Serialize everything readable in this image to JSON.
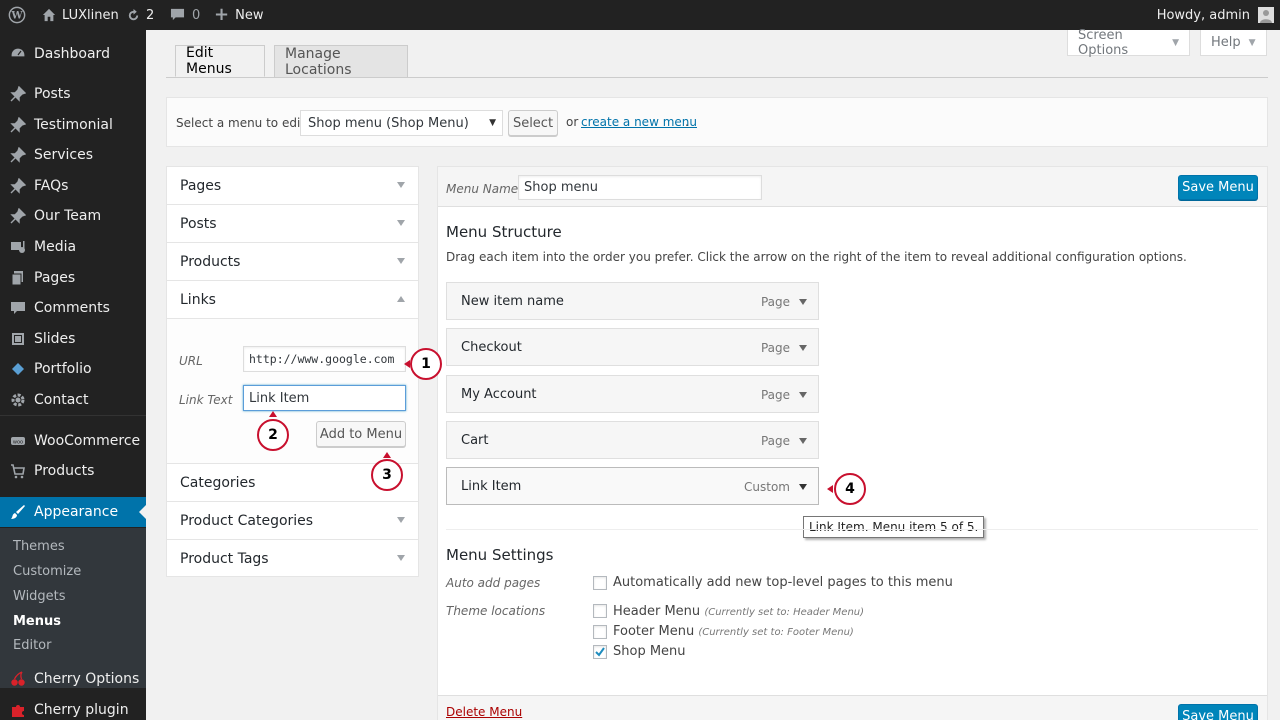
{
  "admin_bar": {
    "site_name": "LUXlinen",
    "updates_count": "2",
    "comments_count": "0",
    "new_label": "New",
    "howdy": "Howdy, admin"
  },
  "sidebar": {
    "items": [
      {
        "label": "Dashboard",
        "icon": "dashboard-icon"
      },
      {
        "label": "Posts",
        "icon": "pin-icon"
      },
      {
        "label": "Testimonial",
        "icon": "pin-icon"
      },
      {
        "label": "Services",
        "icon": "pin-icon"
      },
      {
        "label": "FAQs",
        "icon": "pin-icon"
      },
      {
        "label": "Our Team",
        "icon": "pin-icon"
      },
      {
        "label": "Media",
        "icon": "media-icon"
      },
      {
        "label": "Pages",
        "icon": "pages-icon"
      },
      {
        "label": "Comments",
        "icon": "comment-icon"
      },
      {
        "label": "Slides",
        "icon": "slides-icon"
      },
      {
        "label": "Portfolio",
        "icon": "portfolio-icon"
      },
      {
        "label": "Contact",
        "icon": "gear-icon"
      },
      {
        "label": "WooCommerce",
        "icon": "woo-icon"
      },
      {
        "label": "Products",
        "icon": "cart-icon"
      },
      {
        "label": "Appearance",
        "icon": "brush-icon"
      },
      {
        "label": "Cherry Options",
        "icon": "cherry-icon"
      },
      {
        "label": "Cherry plugin",
        "icon": "puzzle-icon"
      }
    ],
    "submenu": [
      "Themes",
      "Customize",
      "Widgets",
      "Menus",
      "Editor"
    ]
  },
  "top_buttons": {
    "screen_options": "Screen Options",
    "help": "Help"
  },
  "tabs": {
    "edit_menus": "Edit Menus",
    "manage_locations": "Manage Locations"
  },
  "select_bar": {
    "label": "Select a menu to edit:",
    "selected": "Shop menu (Shop Menu)",
    "select_button": "Select",
    "or_text": "or",
    "create_link": "create a new menu",
    "period": "."
  },
  "left_panel": {
    "sections": [
      "Pages",
      "Posts",
      "Products",
      "Links",
      "Categories",
      "Product Categories",
      "Product Tags"
    ],
    "url_label": "URL",
    "url_value": "http://www.google.com",
    "link_text_label": "Link Text",
    "link_text_value": "Link Item",
    "add_button": "Add to Menu"
  },
  "menu_editor": {
    "name_label": "Menu Name",
    "name_value": "Shop menu",
    "save_button": "Save Menu",
    "structure_title": "Menu Structure",
    "structure_desc": "Drag each item into the order you prefer. Click the arrow on the right of the item to reveal additional configuration options.",
    "items": [
      {
        "title": "New item name",
        "type": "Page"
      },
      {
        "title": "Checkout",
        "type": "Page"
      },
      {
        "title": "My Account",
        "type": "Page"
      },
      {
        "title": "Cart",
        "type": "Page"
      },
      {
        "title": "Link Item",
        "type": "Custom"
      }
    ],
    "tooltip": "Link Item. Menu item 5 of 5.",
    "settings_title": "Menu Settings",
    "auto_add_label": "Auto add pages",
    "auto_add_text": "Automatically add new top-level pages to this menu",
    "theme_locations_label": "Theme locations",
    "locations": [
      {
        "name": "Header Menu",
        "note": "(Currently set to: Header Menu)",
        "checked": false
      },
      {
        "name": "Footer Menu",
        "note": "(Currently set to: Footer Menu)",
        "checked": false
      },
      {
        "name": "Shop Menu",
        "note": "",
        "checked": true
      }
    ],
    "delete_link": "Delete Menu"
  },
  "callouts": [
    "1",
    "2",
    "3",
    "4"
  ],
  "colors": {
    "accent": "#0073aa",
    "primary_button": "#0085ba",
    "callout": "#c8102e",
    "admin_bar": "#222222"
  }
}
